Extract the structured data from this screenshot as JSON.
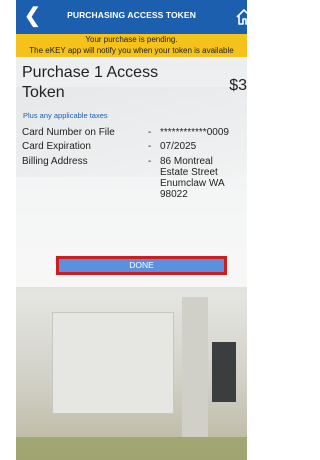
{
  "header": {
    "title": "PURCHASING ACCESS TOKEN",
    "back_icon": "chevron-left-icon",
    "home_icon": "home-icon"
  },
  "banner": {
    "line1": "Your purchase is pending.",
    "line2": "The eKEY app will notify you when your token is available"
  },
  "purchase": {
    "title_line1": "Purchase 1 Access",
    "title_line2": "Token",
    "price": "$3",
    "tax_note": "Plus any applicable taxes",
    "card_label": "Card Number on File",
    "card_value": "************0009",
    "exp_label": "Card Expiration",
    "exp_value": "07/2025",
    "billing_label": "Billing Address",
    "billing_line1": "86 Montreal",
    "billing_line2": "Estate Street",
    "billing_line3": "Enumclaw  WA",
    "billing_line4": "98022",
    "dash": "-"
  },
  "actions": {
    "done_label": "DONE"
  }
}
